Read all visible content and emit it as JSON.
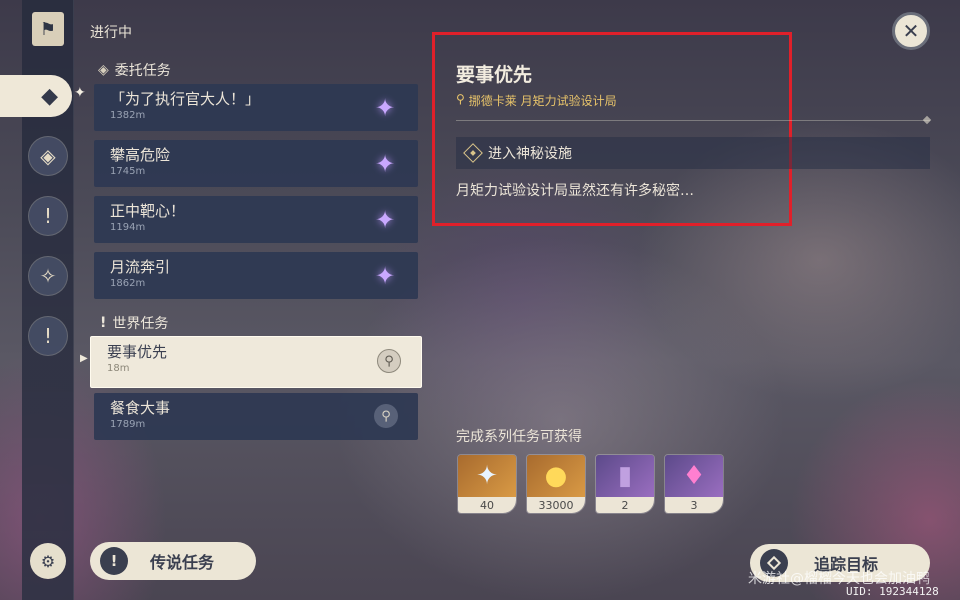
{
  "header": {
    "in_progress_label": "进行中"
  },
  "sidebar": {
    "icons": [
      "bookmark-icon",
      "commission-icon",
      "archon-quest-icon",
      "world-quest-icon",
      "story-quest-icon",
      "exclamation-icon",
      "settings-icon"
    ]
  },
  "commissions": {
    "title": "委托任务",
    "items": [
      {
        "title": "「为了执行官大人！」",
        "distance": "1382m"
      },
      {
        "title": "攀高危险",
        "distance": "1745m"
      },
      {
        "title": "正中靶心！",
        "distance": "1194m"
      },
      {
        "title": "月流奔引",
        "distance": "1862m"
      }
    ]
  },
  "world_quests": {
    "title": "世界任务",
    "items": [
      {
        "title": "要事优先",
        "distance": "18m",
        "selected": true
      },
      {
        "title": "餐食大事",
        "distance": "1789m",
        "selected": false
      }
    ]
  },
  "legend_button": {
    "label": "传说任务"
  },
  "detail": {
    "title": "要事优先",
    "location": "挪德卡莱 月矩力试验设计局",
    "objective": "进入神秘设施",
    "description": "月矩力试验设计局显然还有许多秘密…",
    "highlight_color": "#e0202a"
  },
  "rewards": {
    "label": "完成系列任务可获得",
    "items": [
      {
        "icon": "primogem-icon",
        "count": "40"
      },
      {
        "icon": "mora-icon",
        "count": "33000"
      },
      {
        "icon": "exp-book-icon",
        "count": "2"
      },
      {
        "icon": "ore-crystal-icon",
        "count": "3"
      }
    ]
  },
  "track_button": {
    "label": "追踪目标"
  },
  "footer": {
    "watermark": "米游社@榴榴今天也会加油鸭",
    "uid": "UID: 192344128"
  }
}
